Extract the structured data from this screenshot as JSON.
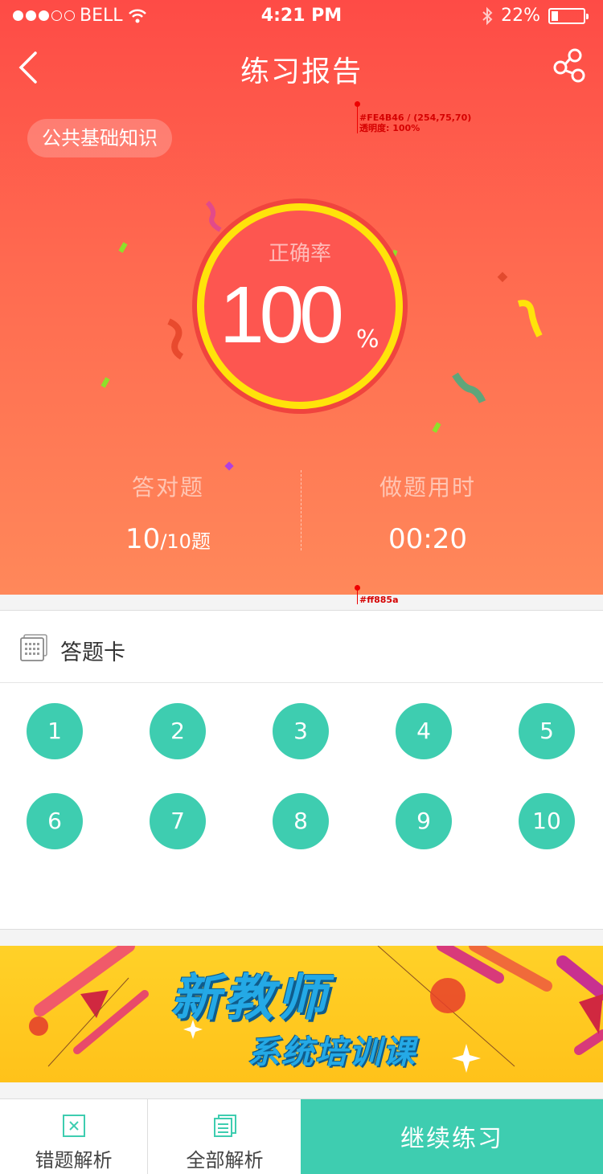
{
  "status_bar": {
    "carrier": "BELL",
    "time": "4:21 PM",
    "battery": "22%",
    "battery_level": 0.22
  },
  "navbar": {
    "title": "练习报告",
    "back_icon": "chevron-left-icon",
    "share_icon": "share-icon"
  },
  "subject_tag": "公共基础知识",
  "score": {
    "label": "正确率",
    "value": "100",
    "unit": "%"
  },
  "stats": {
    "correct_label": "答对题",
    "correct_value": "10",
    "correct_total": "/10题",
    "time_label": "做题用时",
    "time_value": "00:20"
  },
  "annotations": {
    "top_line1": "#FE4B46 / (254,75,70)",
    "top_line2": "透明度: 100%",
    "bottom": "#ff885a"
  },
  "answer_card": {
    "title": "答题卡",
    "icon": "answer-card-icon",
    "questions": [
      "1",
      "2",
      "3",
      "4",
      "5",
      "6",
      "7",
      "8",
      "9",
      "10"
    ]
  },
  "banner": {
    "title": "新教师",
    "subtitle": "系统培训课"
  },
  "bottom_bar": {
    "wrong_label": "错题解析",
    "all_label": "全部解析",
    "continue_label": "继续练习"
  },
  "colors": {
    "hero_top": "#FE4B46",
    "hero_bottom": "#ff885a",
    "accent": "#3ecdb0",
    "ring": "#ffe30a"
  }
}
